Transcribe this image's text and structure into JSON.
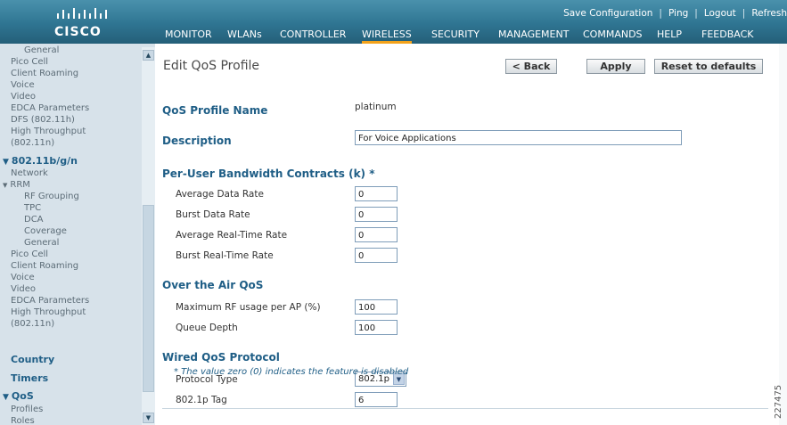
{
  "header": {
    "brand": "CISCO",
    "utility": [
      "Save Configuration",
      "Ping",
      "Logout",
      "Refresh"
    ],
    "tabs": [
      "MONITOR",
      "WLANs",
      "CONTROLLER",
      "WIRELESS",
      "SECURITY",
      "MANAGEMENT",
      "COMMANDS",
      "HELP",
      "FEEDBACK"
    ],
    "active_tab": "WIRELESS"
  },
  "sidebar": {
    "items_top": [
      "General",
      "Pico Cell",
      "Client Roaming",
      "Voice",
      "Video",
      "EDCA Parameters",
      "DFS (802.11h)",
      "High Throughput",
      "(802.11n)"
    ],
    "band": "802.11b/g/n",
    "band_items": [
      "Network",
      "RRM",
      "RF Grouping",
      "TPC",
      "DCA",
      "Coverage",
      "General",
      "Pico Cell",
      "Client Roaming",
      "Voice",
      "Video",
      "EDCA Parameters",
      "High Throughput",
      "(802.11n)"
    ],
    "country": "Country",
    "timers": "Timers",
    "qos": "QoS",
    "qos_items": [
      "Profiles",
      "Roles"
    ]
  },
  "page": {
    "title": "Edit QoS Profile",
    "buttons": {
      "back": "< Back",
      "apply": "Apply",
      "reset": "Reset to defaults"
    },
    "profile_name_label": "QoS Profile Name",
    "profile_name_value": "platinum",
    "description_label": "Description",
    "description_value": "For Voice Applications",
    "bandwidth_section": "Per-User Bandwidth Contracts (k) *",
    "bandwidth_fields": [
      {
        "label": "Average Data Rate",
        "value": "0"
      },
      {
        "label": "Burst Data Rate",
        "value": "0"
      },
      {
        "label": "Average Real-Time Rate",
        "value": "0"
      },
      {
        "label": "Burst Real-Time Rate",
        "value": "0"
      }
    ],
    "air_section": "Over the Air QoS",
    "air_fields": [
      {
        "label": "Maximum RF usage per AP (%)",
        "value": "100"
      },
      {
        "label": "Queue Depth",
        "value": "100"
      }
    ],
    "wired_section": "Wired QoS Protocol",
    "protocol_type_label": "Protocol Type",
    "protocol_type_value": "802.1p",
    "tag_label": "802.1p Tag",
    "tag_value": "6",
    "note": "* The value zero (0) indicates the feature is disabled"
  },
  "figure_id": "227475",
  "colors": {
    "header": "#2f7592",
    "accent": "#f3a21b",
    "sidebar": "#d7e2ea",
    "section": "#1f5e86"
  }
}
